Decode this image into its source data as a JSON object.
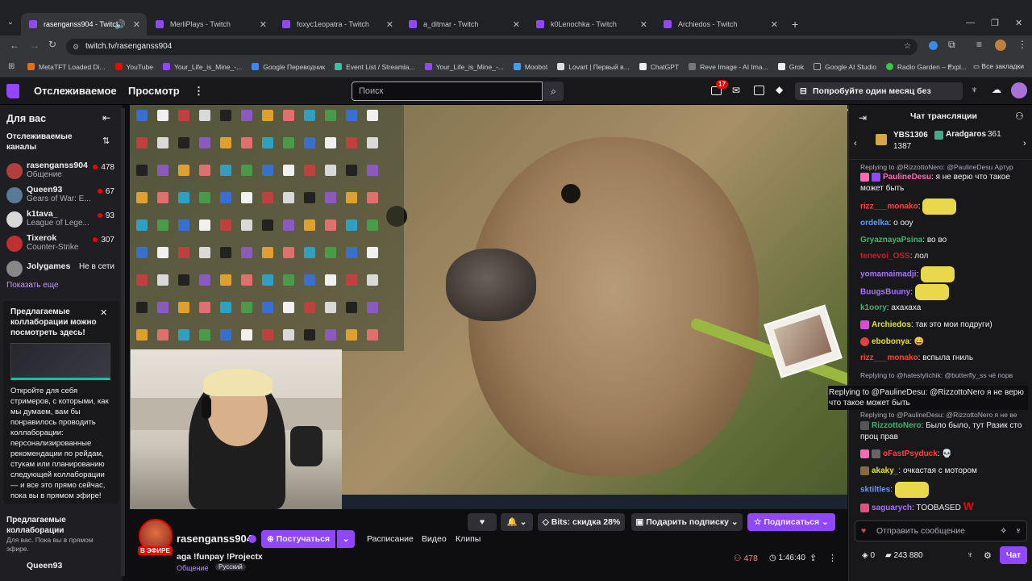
{
  "browser": {
    "tabs": [
      {
        "title": "rasenganss904 - Twitch",
        "active": true
      },
      {
        "title": "MerliPlays - Twitch"
      },
      {
        "title": "foxyc1eopatra - Twitch"
      },
      {
        "title": "a_ditmar - Twitch"
      },
      {
        "title": "k0Lenochka - Twitch"
      },
      {
        "title": "Archiedos - Twitch"
      }
    ],
    "new_tab": "+",
    "url": "twitch.tv/rasenganss904",
    "bookmarks": [
      "MetaTFT Loaded Di...",
      "YouTube",
      "Your_Life_is_Mine_-...",
      "Google Переводчик",
      "Event List / Streamla...",
      "Your_Life_is_Mine_-...",
      "Moobot",
      "Lovart | Первый в...",
      "ChatGPT",
      "Reve Image - AI Ima...",
      "Grok",
      "Google AI Studio",
      "Radio Garden – Expl..."
    ],
    "all_bookmarks": "Все закладки"
  },
  "nav": {
    "following": "Отслеживаемое",
    "browse": "Просмотр",
    "more": "⋮",
    "search_placeholder": "Поиск",
    "notif_count": "17",
    "promo": "Попробуйте один месяц без рекламы"
  },
  "sidebar": {
    "for_you": "Для вас",
    "followed_header": "Отслеживаемые каналы",
    "channels": [
      {
        "name": "rasenganss904",
        "game": "Общение",
        "viewers": "478",
        "color": "#b04040"
      },
      {
        "name": "Queen93",
        "game": "Gears of War: E...",
        "viewers": "67",
        "color": "#5a7a9a"
      },
      {
        "name": "k1tava_",
        "game": "League of Lege...",
        "viewers": "93",
        "color": "#d8d8d8"
      },
      {
        "name": "Tixerok",
        "game": "Counter-Strike",
        "viewers": "307",
        "color": "#c03030"
      },
      {
        "name": "Jolygames",
        "game": "",
        "viewers": "",
        "status": "Не в сети",
        "color": "#888888"
      }
    ],
    "show_more": "Показать еще",
    "collab_card_title": "Предлагаемые коллаборации можно посмотреть здесь!",
    "collab_card_body": "Откройте для себя стримеров, с которыми, как мы думаем, вам бы понравилось проводить коллаборации: персонализированные рекомендации по рейдам, стукам или планированию следующей коллаборации — и все это прямо сейчас, пока вы в прямом эфире!",
    "suggested_header": "Предлагаемые коллаборации",
    "suggested_sub": "Для вас. Пока вы в прямом эфире.",
    "suggested_first": "Queen93"
  },
  "stream": {
    "live_badge": "В ЭФИРЕ",
    "channel_name": "rasenganss904",
    "follow_label": "Постучаться",
    "tab_schedule": "Расписание",
    "tab_videos": "Видео",
    "tab_clips": "Клипы",
    "title": "aga !funpay !Projectx",
    "category": "Общение",
    "tag": "Русский",
    "viewers": "478",
    "uptime": "1:46:40",
    "bits_label": "Bits: скидка 28%",
    "gift_label": "Подарить подписку",
    "subscribe_label": "Подписаться"
  },
  "chat": {
    "header": "Чат трансляции",
    "hype": [
      {
        "name": "YBS1306",
        "value": "1387"
      },
      {
        "name": "Aradgaros",
        "value": "361"
      }
    ],
    "messages": [
      {
        "type": "reply",
        "text": "Replying to @RizzottoNero: @PaulineDesu Артур"
      },
      {
        "user": "PaulineDesu",
        "color": "#ff69b4",
        "text": "я не верю что такое может быть"
      },
      {
        "user": "rizz___monako",
        "color": "#ff4040",
        "text": "",
        "emote": true
      },
      {
        "user": "ordelka",
        "color": "#5b99ff",
        "text": "о ооу"
      },
      {
        "user": "GryaznayaPsina",
        "color": "#3cb371",
        "text": "во во"
      },
      {
        "user": "tenevoi_OSS",
        "color": "#cc2020",
        "text": "лол"
      },
      {
        "user": "yomamaimadji",
        "color": "#a970ff",
        "text": "",
        "emote": true
      },
      {
        "user": "BuugsBuuny",
        "color": "#a970ff",
        "text": "",
        "emote": true
      },
      {
        "user": "k1oory",
        "color": "#3cb371",
        "text": "ахахаха"
      },
      {
        "user": "Archiedos",
        "color": "#e6e600",
        "text": "так это мои подруги)"
      },
      {
        "user": "ebobonya",
        "color": "#e6e600",
        "text": "😄"
      },
      {
        "user": "rizz___monako",
        "color": "#ff4040",
        "text": "вспыла гниль"
      },
      {
        "type": "reply",
        "text": "Replying to @hatestylichik: @butterfly_ss чё порв"
      },
      {
        "type": "reply",
        "text": "Replying to @PaulineDesu: @RizzottoNero я не ве"
      },
      {
        "user": "RizzottoNero",
        "color": "#3cb371",
        "text": "Было было, тут Разик сто проц прав"
      },
      {
        "user": "oFastPsyduck",
        "color": "#ff4040",
        "text": "💀"
      },
      {
        "user": "akaky_",
        "color": "#e6e600",
        "text": "очкастая с мотором"
      },
      {
        "user": "sktiltles",
        "color": "#5b99ff",
        "text": "",
        "emote": true
      },
      {
        "user": "saguarych",
        "color": "#a970ff",
        "text": "TOOBASED",
        "w": "W"
      }
    ],
    "tooltip": "Replying to @PaulineDesu: @RizzottoNero я не верю что такое может быть",
    "input_placeholder": "Отправить сообщение",
    "bits": "0",
    "points": "243 880",
    "chat_button": "Чат"
  }
}
